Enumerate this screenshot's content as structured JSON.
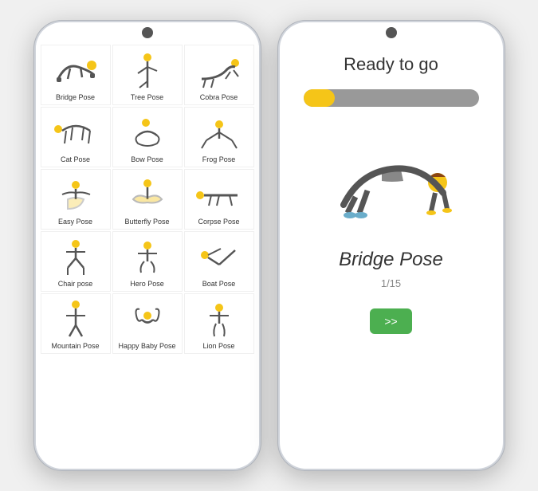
{
  "left_phone": {
    "poses": [
      {
        "label": "Bridge Pose",
        "id": "bridge"
      },
      {
        "label": "Tree Pose",
        "id": "tree"
      },
      {
        "label": "Cobra Pose",
        "id": "cobra"
      },
      {
        "label": "Cat Pose",
        "id": "cat"
      },
      {
        "label": "Bow Pose",
        "id": "bow"
      },
      {
        "label": "Frog Pose",
        "id": "frog"
      },
      {
        "label": "Easy Pose",
        "id": "easy"
      },
      {
        "label": "Butterfly Pose",
        "id": "butterfly"
      },
      {
        "label": "Corpse Pose",
        "id": "corpse"
      },
      {
        "label": "Chair pose",
        "id": "chair"
      },
      {
        "label": "Hero Pose",
        "id": "hero"
      },
      {
        "label": "Boat Pose",
        "id": "boat"
      },
      {
        "label": "Mountain Pose",
        "id": "mountain"
      },
      {
        "label": "Happy Baby Pose",
        "id": "happybaby"
      },
      {
        "label": "Lion Pose",
        "id": "lion"
      }
    ]
  },
  "right_phone": {
    "ready_text": "Ready to go",
    "pose_name": "Bridge Pose",
    "counter": "1/15",
    "next_label": ">>",
    "progress_percent": 18
  }
}
